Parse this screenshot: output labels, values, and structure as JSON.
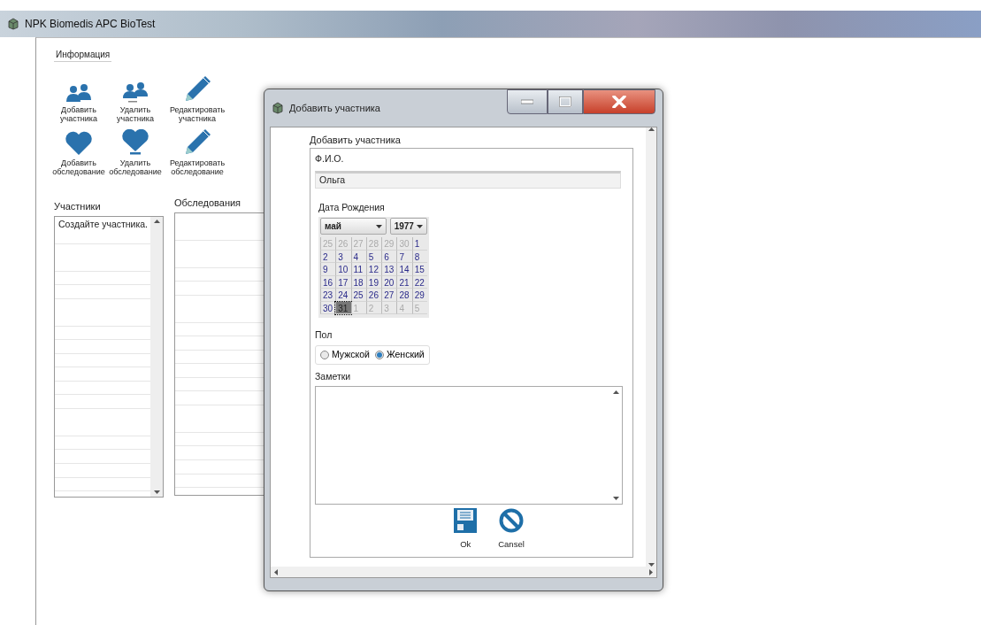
{
  "window": {
    "title": "NPK Biomedis APC BioTest"
  },
  "tabs": [
    {
      "label": "Информация",
      "selected": true
    }
  ],
  "toolbar": [
    {
      "label": "Добавить участника",
      "kind": "people"
    },
    {
      "label": "Удалить участника",
      "kind": "people-remove"
    },
    {
      "label": "Редактировать участника",
      "kind": "pencil"
    },
    {
      "label": "Добавить обследование",
      "kind": "heart"
    },
    {
      "label": "Удалить обследование",
      "kind": "heart-remove"
    },
    {
      "label": "Редактировать обследование",
      "kind": "pencil"
    }
  ],
  "participants": {
    "title": "Участники",
    "items": [
      "Создайте участника."
    ]
  },
  "examinations": {
    "title": "Обследования"
  },
  "dialog": {
    "title": "Добавить участника",
    "group_title": "Добавить участника",
    "name_label": "Ф.И.О.",
    "name_value": "Ольга",
    "birth_label": "Дата Рождения",
    "month": "май",
    "year": "1977",
    "weeks": [
      [
        {
          "day": "25",
          "other_month": true,
          "selected": false
        },
        {
          "day": "26",
          "other_month": true,
          "selected": false
        },
        {
          "day": "27",
          "other_month": true,
          "selected": false
        },
        {
          "day": "28",
          "other_month": true,
          "selected": false
        },
        {
          "day": "29",
          "other_month": true,
          "selected": false
        },
        {
          "day": "30",
          "other_month": true,
          "selected": false
        },
        {
          "day": "1",
          "other_month": false,
          "selected": false
        }
      ],
      [
        {
          "day": "2",
          "other_month": false,
          "selected": false
        },
        {
          "day": "3",
          "other_month": false,
          "selected": false
        },
        {
          "day": "4",
          "other_month": false,
          "selected": false
        },
        {
          "day": "5",
          "other_month": false,
          "selected": false
        },
        {
          "day": "6",
          "other_month": false,
          "selected": false
        },
        {
          "day": "7",
          "other_month": false,
          "selected": false
        },
        {
          "day": "8",
          "other_month": false,
          "selected": false
        }
      ],
      [
        {
          "day": "9",
          "other_month": false,
          "selected": false
        },
        {
          "day": "10",
          "other_month": false,
          "selected": false
        },
        {
          "day": "11",
          "other_month": false,
          "selected": false
        },
        {
          "day": "12",
          "other_month": false,
          "selected": false
        },
        {
          "day": "13",
          "other_month": false,
          "selected": false
        },
        {
          "day": "14",
          "other_month": false,
          "selected": false
        },
        {
          "day": "15",
          "other_month": false,
          "selected": false
        }
      ],
      [
        {
          "day": "16",
          "other_month": false,
          "selected": false
        },
        {
          "day": "17",
          "other_month": false,
          "selected": false
        },
        {
          "day": "18",
          "other_month": false,
          "selected": false
        },
        {
          "day": "19",
          "other_month": false,
          "selected": false
        },
        {
          "day": "20",
          "other_month": false,
          "selected": false
        },
        {
          "day": "21",
          "other_month": false,
          "selected": false
        },
        {
          "day": "22",
          "other_month": false,
          "selected": false
        }
      ],
      [
        {
          "day": "23",
          "other_month": false,
          "selected": false
        },
        {
          "day": "24",
          "other_month": false,
          "selected": false
        },
        {
          "day": "25",
          "other_month": false,
          "selected": false
        },
        {
          "day": "26",
          "other_month": false,
          "selected": false
        },
        {
          "day": "27",
          "other_month": false,
          "selected": false
        },
        {
          "day": "28",
          "other_month": false,
          "selected": false
        },
        {
          "day": "29",
          "other_month": false,
          "selected": false
        }
      ],
      [
        {
          "day": "30",
          "other_month": false,
          "selected": false
        },
        {
          "day": "31",
          "other_month": false,
          "selected": true
        },
        {
          "day": "1",
          "other_month": true,
          "selected": false
        },
        {
          "day": "2",
          "other_month": true,
          "selected": false
        },
        {
          "day": "3",
          "other_month": true,
          "selected": false
        },
        {
          "day": "4",
          "other_month": true,
          "selected": false
        },
        {
          "day": "5",
          "other_month": true,
          "selected": false
        }
      ]
    ],
    "gender_label": "Пол",
    "genders": [
      {
        "label": "Мужской",
        "selected": false
      },
      {
        "label": "Женский",
        "selected": true
      }
    ],
    "notes_label": "Заметки",
    "buttons": [
      {
        "label": "Ok",
        "kind": "save"
      },
      {
        "label": "Cansel",
        "kind": "cancel"
      }
    ]
  }
}
